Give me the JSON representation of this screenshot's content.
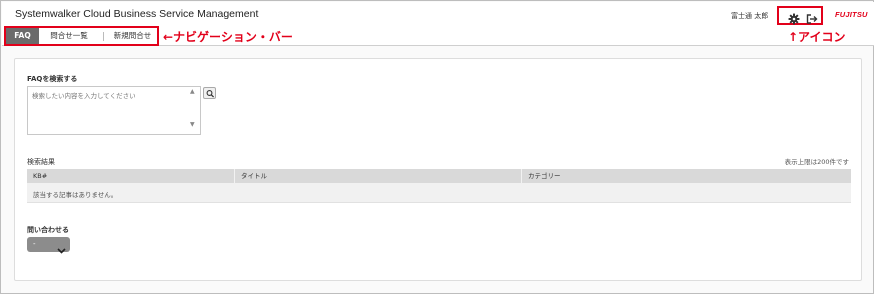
{
  "header": {
    "app_title": "Systemwalker Cloud Business Service Management",
    "user_name": "富士通 太郎",
    "logo_text": "FUJITSU",
    "icons": [
      "gear-icon",
      "logout-icon"
    ]
  },
  "nav": {
    "tabs": [
      {
        "label": "FAQ",
        "active": true
      },
      {
        "label": "問合せ一覧",
        "active": false
      },
      {
        "label": "新規問合せ",
        "active": false
      }
    ]
  },
  "annotations": {
    "nav_label": "←ナビゲーション・バー",
    "icon_label": "↑アイコン"
  },
  "faq_search": {
    "label": "FAQを検索する",
    "placeholder": "検索したい内容を入力してください"
  },
  "results": {
    "label": "検索結果",
    "limit_note": "表示上限は200件です",
    "columns": [
      "KB#",
      "タイトル",
      "カテゴリー"
    ],
    "empty_message": "該当する記事はありません。"
  },
  "inquiry": {
    "label": "問い合わせる",
    "selected": "-"
  },
  "colors": {
    "accent_red": "#e2001a",
    "active_tab": "#6b6b6b",
    "table_header": "#d9d9d9"
  }
}
